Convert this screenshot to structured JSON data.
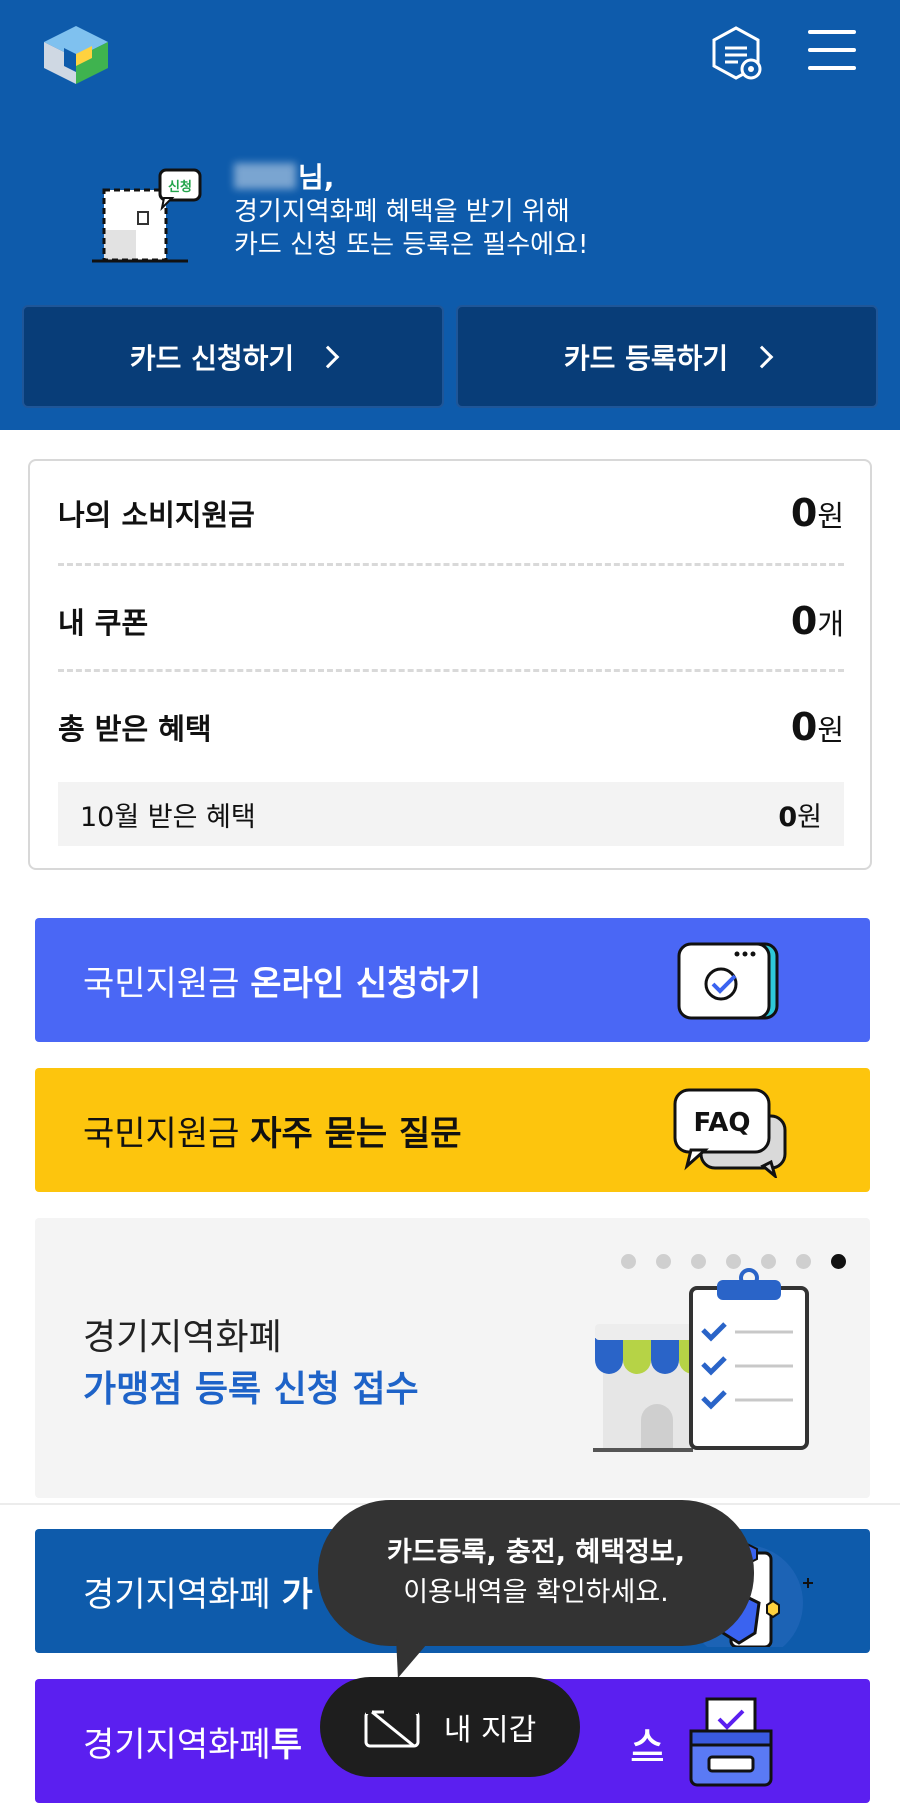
{
  "header": {
    "greeting_suffix": "님,",
    "message_line1": "경기지역화폐 혜택을 받기 위해",
    "message_line2": "카드 신청 또는 등록은 필수에요!",
    "illust_badge": "신청",
    "apply_button": "카드 신청하기",
    "register_button": "카드 등록하기",
    "brand_color": "#0E5BAB"
  },
  "summary": {
    "subsidy_label": "나의 소비지원금",
    "subsidy_value": "0",
    "subsidy_unit": "원",
    "coupon_label": "내 쿠폰",
    "coupon_value": "0",
    "coupon_unit": "개",
    "total_label": "총 받은 혜택",
    "total_value": "0",
    "total_unit": "원",
    "month_label": "10월 받은 혜택",
    "month_value": "0",
    "month_unit": "원"
  },
  "banners": {
    "online_apply": {
      "prefix": "국민지원금 ",
      "bold": "온라인 신청하기",
      "color": "#4A67F5"
    },
    "faq": {
      "prefix": "국민지원금 ",
      "bold": "자주 묻는 질문",
      "icon_text": "FAQ",
      "color": "#FDC50D"
    },
    "merchant": {
      "line1": "경기지역화폐",
      "line2": "가맹점 등록 신청 접수",
      "active_dot": 7,
      "dot_count": 7
    },
    "navy_banner": {
      "prefix": "경기지역화폐 ",
      "bold": "가",
      "color": "#0E5BAB"
    },
    "purple_banner": {
      "prefix": "경기지역화폐 ",
      "bold": "투",
      "bold_end": "스",
      "color": "#5B1FF0"
    }
  },
  "tooltip": {
    "line1": "카드등록, 충전, 혜택정보,",
    "line2": "이용내역을 확인하세요."
  },
  "wallet": {
    "label": "내 지갑"
  }
}
